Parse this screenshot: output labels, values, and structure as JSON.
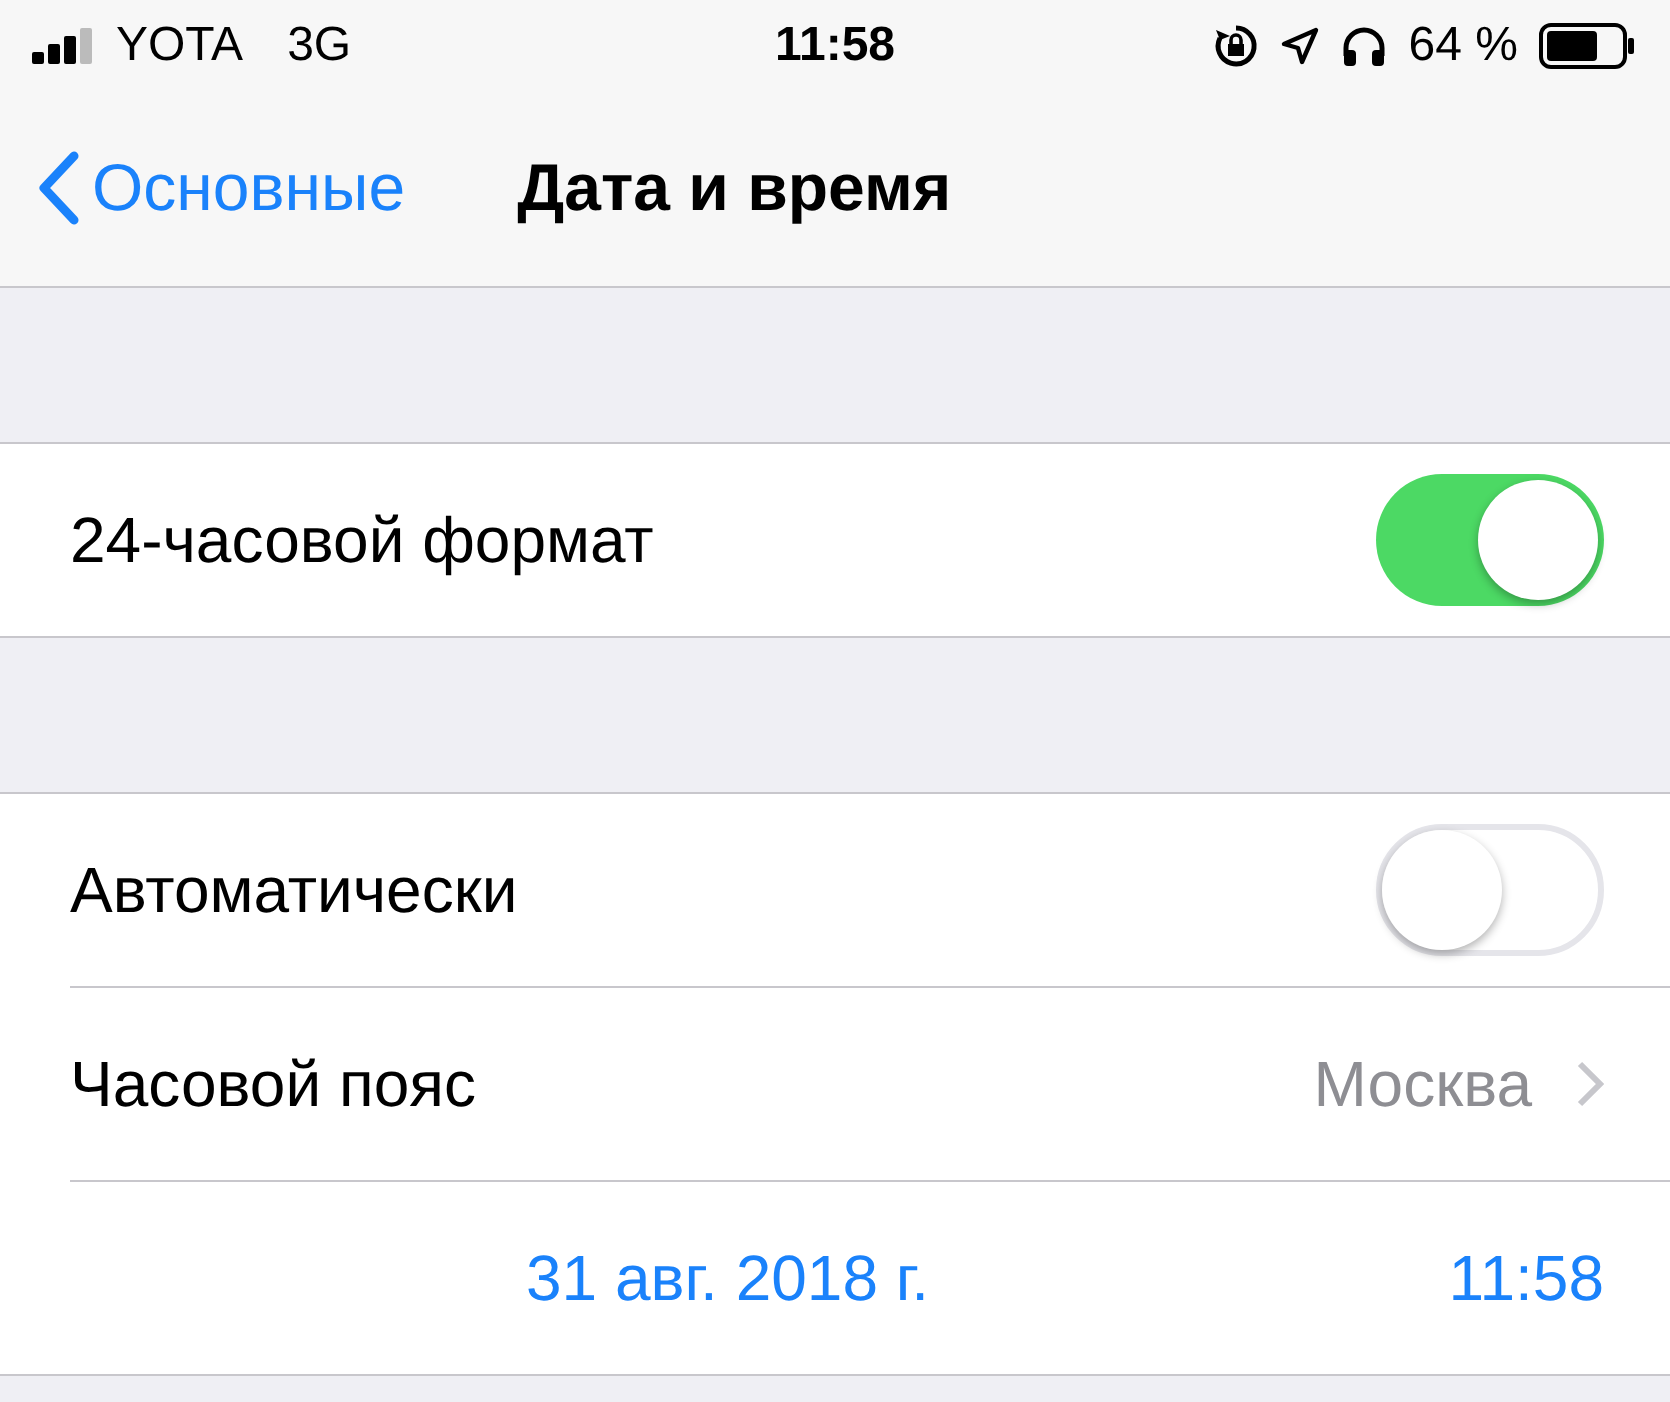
{
  "status_bar": {
    "carrier": "YOTA",
    "network": "3G",
    "time": "11:58",
    "battery": "64 %"
  },
  "nav": {
    "back": "Основные",
    "title": "Дата и время"
  },
  "sections": [
    {
      "rows": [
        {
          "kind": "toggle",
          "label": "24-часовой формат",
          "on": true
        }
      ]
    },
    {
      "rows": [
        {
          "kind": "toggle",
          "label": "Автоматически",
          "on": false
        },
        {
          "kind": "disclosure",
          "label": "Часовой пояс",
          "value": "Москва"
        },
        {
          "kind": "datetime",
          "date": "31 авг. 2018 г.",
          "time": "11:58"
        }
      ]
    }
  ]
}
